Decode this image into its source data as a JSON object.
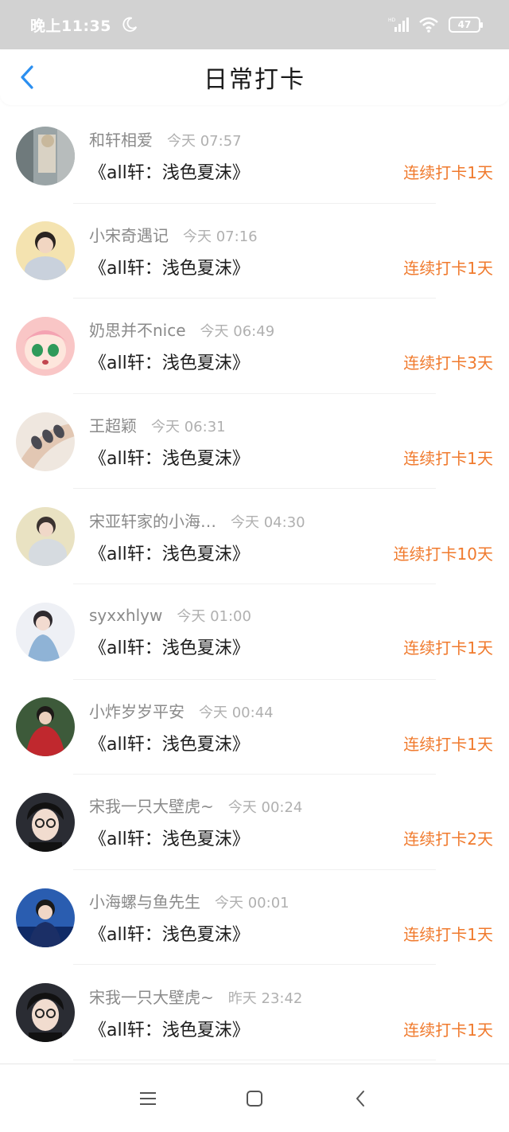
{
  "status_bar": {
    "time": "晚上11:35",
    "battery": "47",
    "network": "HD"
  },
  "header": {
    "title": "日常打卡"
  },
  "colors": {
    "accent": "#f07a2d",
    "back": "#2b8ff0"
  },
  "items": [
    {
      "user": "和轩相爱",
      "time": "今天 07:57",
      "book": "《all轩：浅色夏沫》",
      "streak": "连续打卡1天"
    },
    {
      "user": "小宋奇遇记",
      "time": "今天 07:16",
      "book": "《all轩：浅色夏沫》",
      "streak": "连续打卡1天"
    },
    {
      "user": "奶思并不nice",
      "time": "今天 06:49",
      "book": "《all轩：浅色夏沫》",
      "streak": "连续打卡3天"
    },
    {
      "user": "王超颖",
      "time": "今天 06:31",
      "book": "《all轩：浅色夏沫》",
      "streak": "连续打卡1天"
    },
    {
      "user": "宋亚轩家的小海…",
      "time": "今天 04:30",
      "book": "《all轩：浅色夏沫》",
      "streak": "连续打卡10天"
    },
    {
      "user": "syxxhlyw",
      "time": "今天 01:00",
      "book": "《all轩：浅色夏沫》",
      "streak": "连续打卡1天"
    },
    {
      "user": "小炸岁岁平安",
      "time": "今天 00:44",
      "book": "《all轩：浅色夏沫》",
      "streak": "连续打卡1天"
    },
    {
      "user": "宋我一只大壁虎~",
      "time": "今天 00:24",
      "book": "《all轩：浅色夏沫》",
      "streak": "连续打卡2天"
    },
    {
      "user": "小海螺与鱼先生",
      "time": "今天 00:01",
      "book": "《all轩：浅色夏沫》",
      "streak": "连续打卡1天"
    },
    {
      "user": "宋我一只大壁虎~",
      "time": "昨天 23:42",
      "book": "《all轩：浅色夏沫》",
      "streak": "连续打卡1天"
    }
  ]
}
